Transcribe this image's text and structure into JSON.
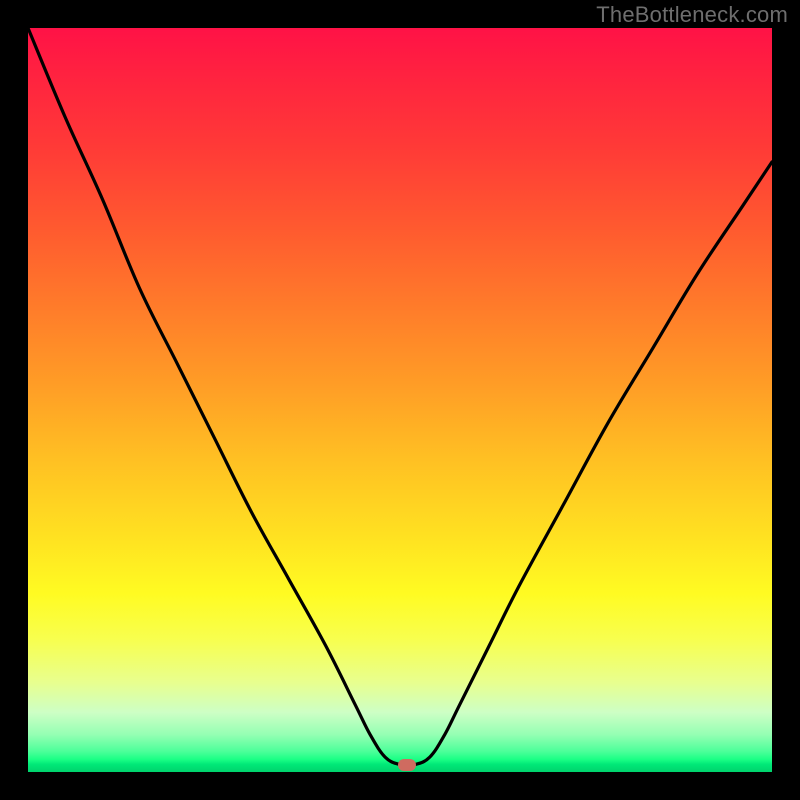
{
  "watermark": "TheBottleneck.com",
  "colors": {
    "background": "#000000",
    "curve_stroke": "#000000",
    "dot": "#cf6b60"
  },
  "chart_data": {
    "type": "line",
    "title": "",
    "xlabel": "",
    "ylabel": "",
    "xlim": [
      0,
      100
    ],
    "ylim": [
      0,
      100
    ],
    "grid": false,
    "annotations": [
      "TheBottleneck.com"
    ],
    "series": [
      {
        "name": "curve",
        "x": [
          0,
          5,
          10,
          15,
          20,
          25,
          30,
          35,
          40,
          44,
          46,
          48,
          50,
          52,
          54,
          56,
          58,
          62,
          66,
          72,
          78,
          84,
          90,
          96,
          100
        ],
        "values": [
          100,
          88,
          77,
          65,
          55,
          45,
          35,
          26,
          17,
          9,
          5,
          2,
          1,
          1,
          2,
          5,
          9,
          17,
          25,
          36,
          47,
          57,
          67,
          76,
          82
        ]
      }
    ],
    "notch": {
      "x": 51,
      "y": 1
    },
    "gradient_stops": [
      {
        "pos": 0.0,
        "color": "#ff1246"
      },
      {
        "pos": 0.16,
        "color": "#ff3a37"
      },
      {
        "pos": 0.38,
        "color": "#ff7d2a"
      },
      {
        "pos": 0.58,
        "color": "#ffc023"
      },
      {
        "pos": 0.76,
        "color": "#fffb22"
      },
      {
        "pos": 0.92,
        "color": "#cdffc5"
      },
      {
        "pos": 0.98,
        "color": "#1bff85"
      },
      {
        "pos": 1.0,
        "color": "#00d36d"
      }
    ]
  }
}
